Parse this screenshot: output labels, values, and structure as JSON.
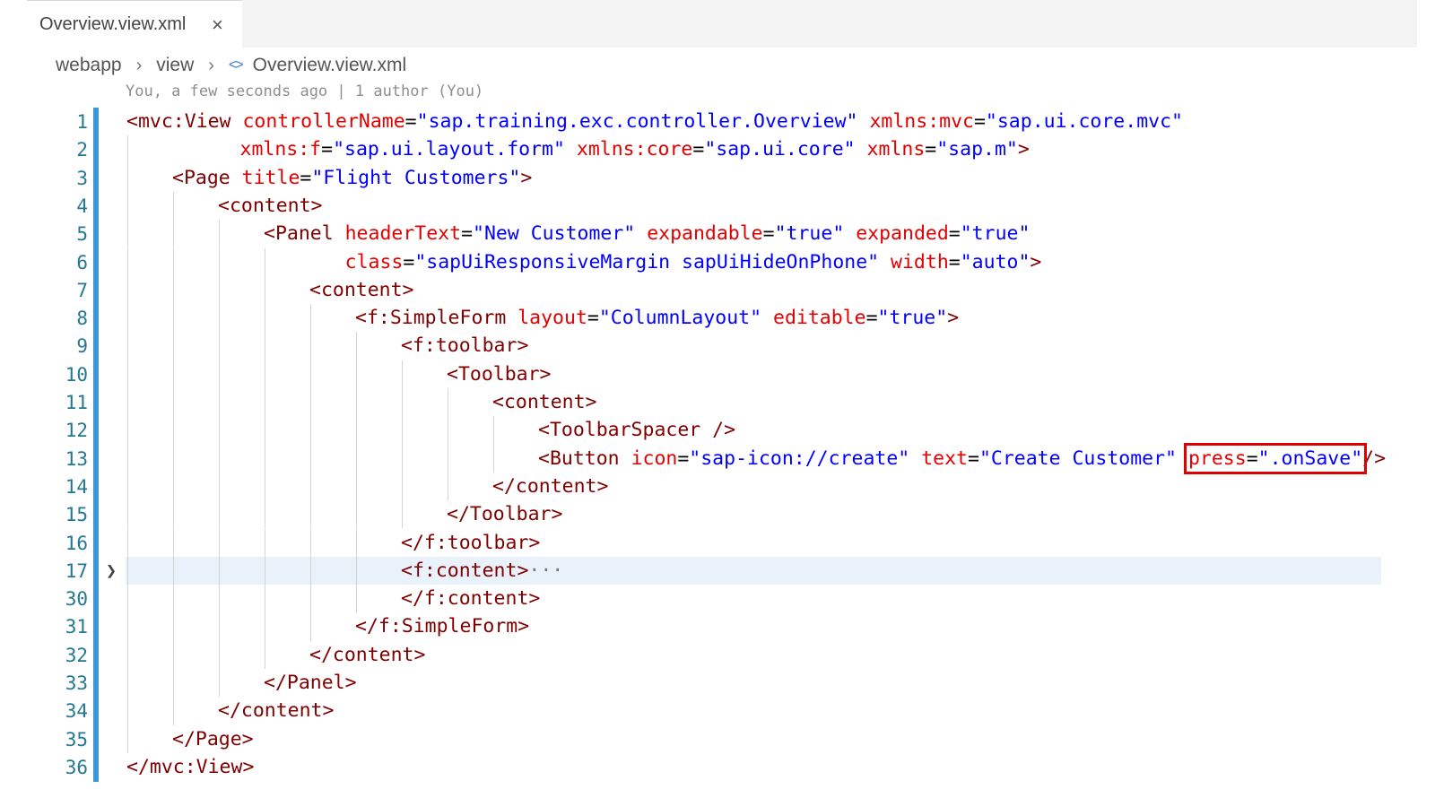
{
  "tab": {
    "filename": "Overview.view.xml"
  },
  "breadcrumb": {
    "items": [
      "webapp",
      "view",
      "Overview.view.xml"
    ]
  },
  "blame": "You, a few seconds ago | 1 author (You)",
  "lines": [
    {
      "num": "1",
      "indent": 0,
      "tokens": [
        [
          "t",
          "<mvc:View "
        ],
        [
          "a",
          "controllerName"
        ],
        [
          "p",
          "="
        ],
        [
          "v",
          "\"sap.training.exc.controller.Overview\""
        ],
        [
          "p",
          " "
        ],
        [
          "a",
          "xmlns:mvc"
        ],
        [
          "p",
          "="
        ],
        [
          "v",
          "\"sap.ui.core.mvc\""
        ]
      ]
    },
    {
      "num": "2",
      "indent": 0,
      "pad": 5,
      "tokens": [
        [
          "a",
          "xmlns:f"
        ],
        [
          "p",
          "="
        ],
        [
          "v",
          "\"sap.ui.layout.form\""
        ],
        [
          "p",
          " "
        ],
        [
          "a",
          "xmlns:core"
        ],
        [
          "p",
          "="
        ],
        [
          "v",
          "\"sap.ui.core\""
        ],
        [
          "p",
          " "
        ],
        [
          "a",
          "xmlns"
        ],
        [
          "p",
          "="
        ],
        [
          "v",
          "\"sap.m\""
        ],
        [
          "t",
          ">"
        ]
      ]
    },
    {
      "num": "3",
      "indent": 1,
      "tokens": [
        [
          "t",
          "<Page "
        ],
        [
          "a",
          "title"
        ],
        [
          "p",
          "="
        ],
        [
          "v",
          "\"Flight Customers\""
        ],
        [
          "t",
          ">"
        ]
      ]
    },
    {
      "num": "4",
      "indent": 2,
      "tokens": [
        [
          "t",
          "<content>"
        ]
      ]
    },
    {
      "num": "5",
      "indent": 3,
      "tokens": [
        [
          "t",
          "<Panel "
        ],
        [
          "a",
          "headerText"
        ],
        [
          "p",
          "="
        ],
        [
          "v",
          "\"New Customer\""
        ],
        [
          "p",
          " "
        ],
        [
          "a",
          "expandable"
        ],
        [
          "p",
          "="
        ],
        [
          "v",
          "\"true\""
        ],
        [
          "p",
          " "
        ],
        [
          "a",
          "expanded"
        ],
        [
          "p",
          "="
        ],
        [
          "v",
          "\"true\""
        ]
      ]
    },
    {
      "num": "6",
      "indent": 3,
      "pad": 3.5,
      "tokens": [
        [
          "a",
          "class"
        ],
        [
          "p",
          "="
        ],
        [
          "v",
          "\"sapUiResponsiveMargin sapUiHideOnPhone\""
        ],
        [
          "p",
          " "
        ],
        [
          "a",
          "width"
        ],
        [
          "p",
          "="
        ],
        [
          "v",
          "\"auto\""
        ],
        [
          "t",
          ">"
        ]
      ]
    },
    {
      "num": "7",
      "indent": 4,
      "tokens": [
        [
          "t",
          "<content>"
        ]
      ]
    },
    {
      "num": "8",
      "indent": 5,
      "tokens": [
        [
          "t",
          "<f:SimpleForm "
        ],
        [
          "a",
          "layout"
        ],
        [
          "p",
          "="
        ],
        [
          "v",
          "\"ColumnLayout\""
        ],
        [
          "p",
          " "
        ],
        [
          "a",
          "editable"
        ],
        [
          "p",
          "="
        ],
        [
          "v",
          "\"true\""
        ],
        [
          "t",
          ">"
        ]
      ]
    },
    {
      "num": "9",
      "indent": 6,
      "tokens": [
        [
          "t",
          "<f:toolbar>"
        ]
      ]
    },
    {
      "num": "10",
      "indent": 7,
      "tokens": [
        [
          "t",
          "<Toolbar>"
        ]
      ]
    },
    {
      "num": "11",
      "indent": 8,
      "tokens": [
        [
          "t",
          "<content>"
        ]
      ]
    },
    {
      "num": "12",
      "indent": 9,
      "tokens": [
        [
          "t",
          "<ToolbarSpacer />"
        ]
      ]
    },
    {
      "num": "13",
      "indent": 9,
      "tokens": [
        [
          "t",
          "<Button "
        ],
        [
          "a",
          "icon"
        ],
        [
          "p",
          "="
        ],
        [
          "v",
          "\"sap-icon://create\""
        ],
        [
          "p",
          " "
        ],
        [
          "a",
          "text"
        ],
        [
          "p",
          "="
        ],
        [
          "v",
          "\"Create Customer\""
        ],
        [
          "p",
          " "
        ],
        [
          "a",
          "press",
          "mark"
        ],
        [
          "p",
          "=",
          "mark"
        ],
        [
          "v",
          "\".onSave\"",
          "mark"
        ],
        [
          "t",
          "/>"
        ]
      ]
    },
    {
      "num": "14",
      "indent": 8,
      "tokens": [
        [
          "t",
          "</content>"
        ]
      ]
    },
    {
      "num": "15",
      "indent": 7,
      "tokens": [
        [
          "t",
          "</Toolbar>"
        ]
      ]
    },
    {
      "num": "16",
      "indent": 6,
      "tokens": [
        [
          "t",
          "</f:toolbar>"
        ]
      ]
    },
    {
      "num": "17",
      "indent": 6,
      "current": true,
      "folded": true,
      "tokens": [
        [
          "t",
          "<f:content>"
        ],
        [
          "ell",
          "···"
        ]
      ]
    },
    {
      "num": "30",
      "indent": 6,
      "tokens": [
        [
          "t",
          "</f:content>"
        ]
      ]
    },
    {
      "num": "31",
      "indent": 5,
      "tokens": [
        [
          "t",
          "</f:SimpleForm>"
        ]
      ]
    },
    {
      "num": "32",
      "indent": 4,
      "tokens": [
        [
          "t",
          "</content>"
        ]
      ]
    },
    {
      "num": "33",
      "indent": 3,
      "tokens": [
        [
          "t",
          "</Panel>"
        ]
      ]
    },
    {
      "num": "34",
      "indent": 2,
      "tokens": [
        [
          "t",
          "</content>"
        ]
      ]
    },
    {
      "num": "35",
      "indent": 1,
      "tokens": [
        [
          "t",
          "</Page>"
        ]
      ]
    },
    {
      "num": "36",
      "indent": 0,
      "tokens": [
        [
          "t",
          "</mvc:View>"
        ]
      ]
    }
  ],
  "icons": {
    "close": "close-icon",
    "chevron": "chevron-right-icon",
    "xml": "xml-file-icon",
    "fold": "fold-chevron-icon"
  },
  "colors": {
    "tag": "#800000",
    "attribute": "#e50000",
    "value": "#0000ff",
    "line_number": "#237893",
    "highlight_box": "#e00000",
    "current_line": "#e9f1fb"
  }
}
